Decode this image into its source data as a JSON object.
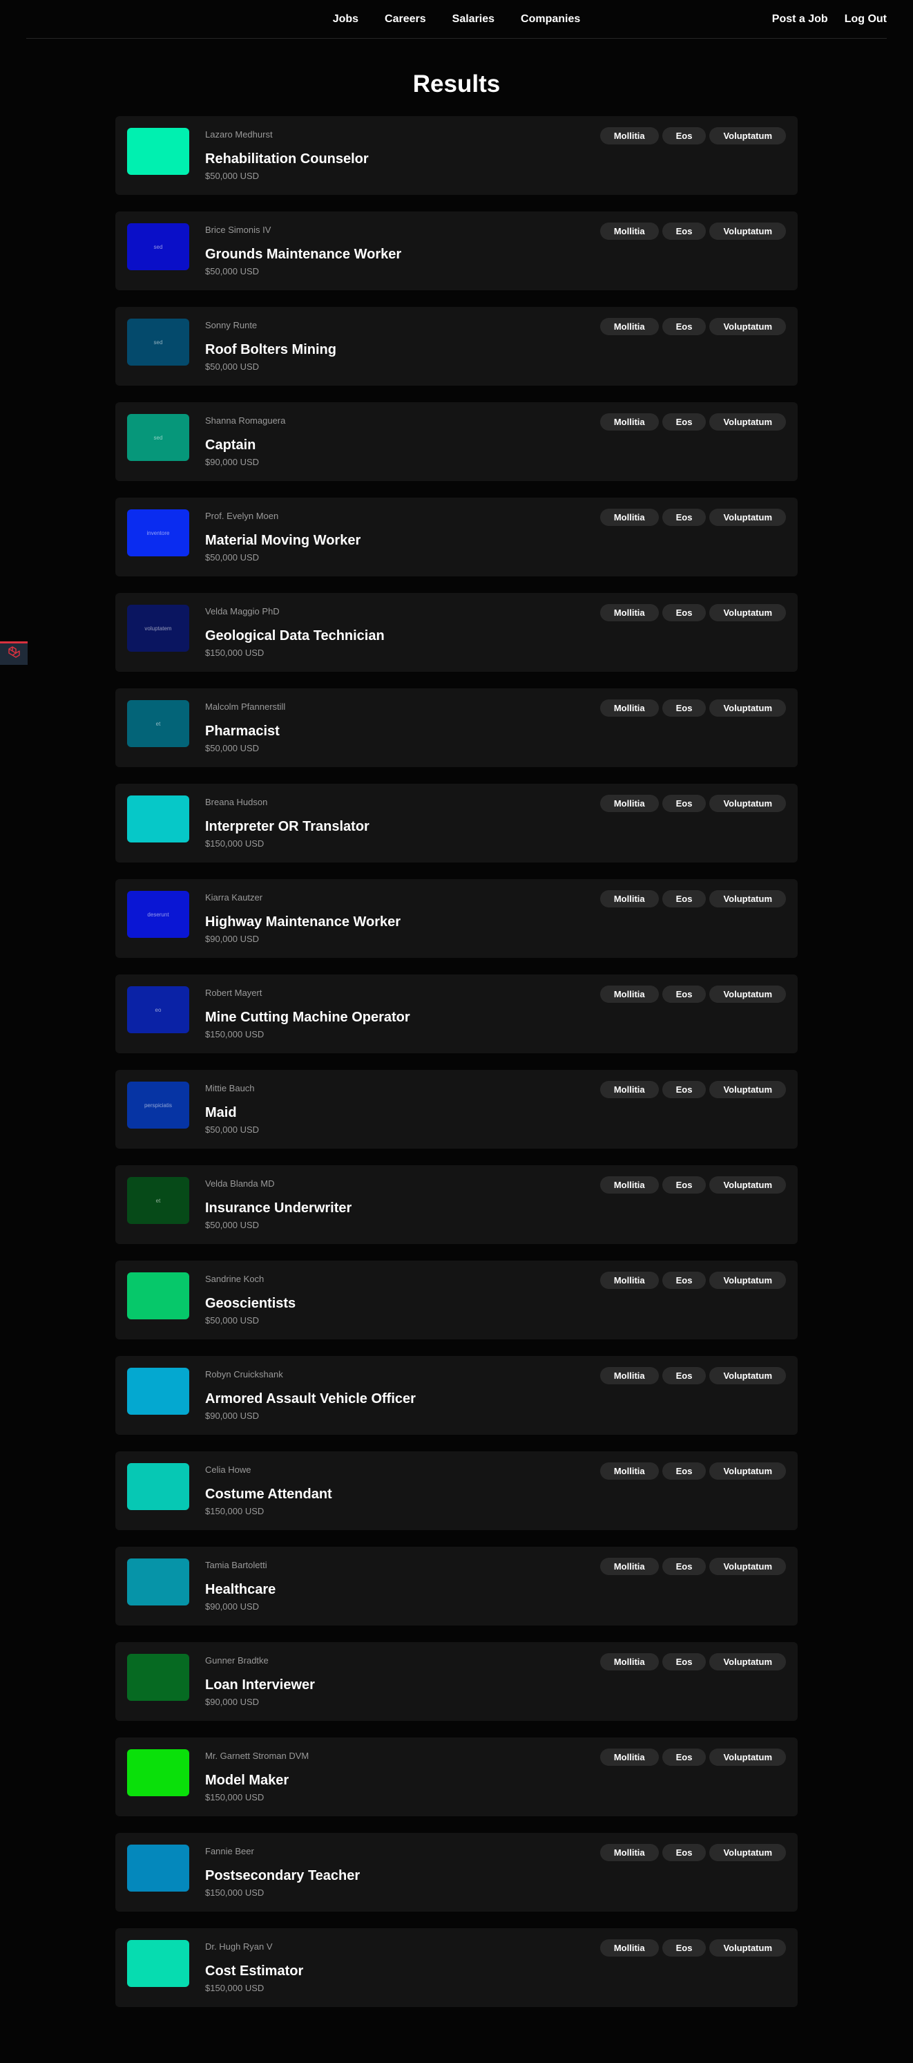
{
  "nav": {
    "center_links": [
      "Jobs",
      "Careers",
      "Salaries",
      "Companies"
    ],
    "right_links": [
      "Post a Job",
      "Log Out"
    ]
  },
  "page": {
    "title": "Results"
  },
  "widget": {
    "icon": "laravel-logo-icon",
    "color": "#d9323f"
  },
  "jobs": [
    {
      "company": "Lazaro Medhurst",
      "title": "Rehabilitation Counselor",
      "salary": "$50,000 USD",
      "thumb_color": "#00f0b0",
      "thumb_text": "",
      "tags": [
        "Mollitia",
        "Eos",
        "Voluptatum"
      ]
    },
    {
      "company": "Brice Simonis IV",
      "title": "Grounds Maintenance Worker",
      "salary": "$50,000 USD",
      "thumb_color": "#0a0fc8",
      "thumb_text": "sed",
      "tags": [
        "Mollitia",
        "Eos",
        "Voluptatum"
      ]
    },
    {
      "company": "Sonny Runte",
      "title": "Roof Bolters Mining",
      "salary": "$50,000 USD",
      "thumb_color": "#044a6c",
      "thumb_text": "sed",
      "tags": [
        "Mollitia",
        "Eos",
        "Voluptatum"
      ]
    },
    {
      "company": "Shanna Romaguera",
      "title": "Captain",
      "salary": "$90,000 USD",
      "thumb_color": "#06977a",
      "thumb_text": "sed",
      "tags": [
        "Mollitia",
        "Eos",
        "Voluptatum"
      ]
    },
    {
      "company": "Prof. Evelyn Moen",
      "title": "Material Moving Worker",
      "salary": "$50,000 USD",
      "thumb_color": "#0a2cf0",
      "thumb_text": "inventore",
      "tags": [
        "Mollitia",
        "Eos",
        "Voluptatum"
      ]
    },
    {
      "company": "Velda Maggio PhD",
      "title": "Geological Data Technician",
      "salary": "$150,000 USD",
      "thumb_color": "#0a1560",
      "thumb_text": "voluptatem",
      "tags": [
        "Mollitia",
        "Eos",
        "Voluptatum"
      ]
    },
    {
      "company": "Malcolm Pfannerstill",
      "title": "Pharmacist",
      "salary": "$50,000 USD",
      "thumb_color": "#036478",
      "thumb_text": "et",
      "tags": [
        "Mollitia",
        "Eos",
        "Voluptatum"
      ]
    },
    {
      "company": "Breana Hudson",
      "title": "Interpreter OR Translator",
      "salary": "$150,000 USD",
      "thumb_color": "#06c8c8",
      "thumb_text": "",
      "tags": [
        "Mollitia",
        "Eos",
        "Voluptatum"
      ]
    },
    {
      "company": "Kiarra Kautzer",
      "title": "Highway Maintenance Worker",
      "salary": "$90,000 USD",
      "thumb_color": "#0a16d4",
      "thumb_text": "deserunt",
      "tags": [
        "Mollitia",
        "Eos",
        "Voluptatum"
      ]
    },
    {
      "company": "Robert Mayert",
      "title": "Mine Cutting Machine Operator",
      "salary": "$150,000 USD",
      "thumb_color": "#0a22a6",
      "thumb_text": "eo",
      "tags": [
        "Mollitia",
        "Eos",
        "Voluptatum"
      ]
    },
    {
      "company": "Mittie Bauch",
      "title": "Maid",
      "salary": "$50,000 USD",
      "thumb_color": "#0634a4",
      "thumb_text": "perspiciatis",
      "tags": [
        "Mollitia",
        "Eos",
        "Voluptatum"
      ]
    },
    {
      "company": "Velda Blanda MD",
      "title": "Insurance Underwriter",
      "salary": "$50,000 USD",
      "thumb_color": "#064a18",
      "thumb_text": "et",
      "tags": [
        "Mollitia",
        "Eos",
        "Voluptatum"
      ]
    },
    {
      "company": "Sandrine Koch",
      "title": "Geoscientists",
      "salary": "$50,000 USD",
      "thumb_color": "#06c86a",
      "thumb_text": "",
      "tags": [
        "Mollitia",
        "Eos",
        "Voluptatum"
      ]
    },
    {
      "company": "Robyn Cruickshank",
      "title": "Armored Assault Vehicle Officer",
      "salary": "$90,000 USD",
      "thumb_color": "#04a8d0",
      "thumb_text": "",
      "tags": [
        "Mollitia",
        "Eos",
        "Voluptatum"
      ]
    },
    {
      "company": "Celia Howe",
      "title": "Costume Attendant",
      "salary": "$150,000 USD",
      "thumb_color": "#06c8b4",
      "thumb_text": "",
      "tags": [
        "Mollitia",
        "Eos",
        "Voluptatum"
      ]
    },
    {
      "company": "Tamia Bartoletti",
      "title": "Healthcare",
      "salary": "$90,000 USD",
      "thumb_color": "#0694a8",
      "thumb_text": "",
      "tags": [
        "Mollitia",
        "Eos",
        "Voluptatum"
      ]
    },
    {
      "company": "Gunner Bradtke",
      "title": "Loan Interviewer",
      "salary": "$90,000 USD",
      "thumb_color": "#066a22",
      "thumb_text": "",
      "tags": [
        "Mollitia",
        "Eos",
        "Voluptatum"
      ]
    },
    {
      "company": "Mr. Garnett Stroman DVM",
      "title": "Model Maker",
      "salary": "$150,000 USD",
      "thumb_color": "#0ae00a",
      "thumb_text": "",
      "tags": [
        "Mollitia",
        "Eos",
        "Voluptatum"
      ]
    },
    {
      "company": "Fannie Beer",
      "title": "Postsecondary Teacher",
      "salary": "$150,000 USD",
      "thumb_color": "#0488bc",
      "thumb_text": "",
      "tags": [
        "Mollitia",
        "Eos",
        "Voluptatum"
      ]
    },
    {
      "company": "Dr. Hugh Ryan V",
      "title": "Cost Estimator",
      "salary": "$150,000 USD",
      "thumb_color": "#06dcb0",
      "thumb_text": "",
      "tags": [
        "Mollitia",
        "Eos",
        "Voluptatum"
      ]
    }
  ]
}
